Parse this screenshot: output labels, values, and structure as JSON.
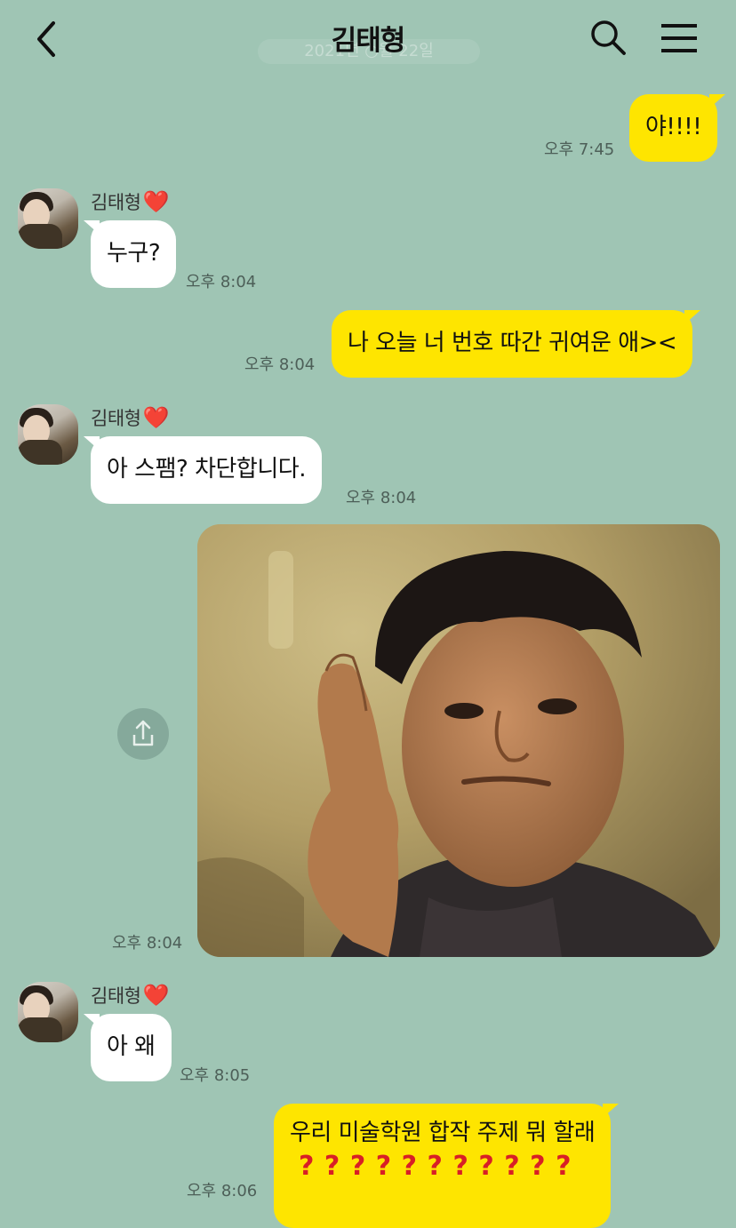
{
  "header": {
    "title": "김태형",
    "date_faded": "2021년 ○월 22일",
    "back_icon": "chevron-left-icon",
    "search_icon": "search-icon",
    "menu_icon": "menu-icon"
  },
  "contact": {
    "name": "김태형",
    "heart": "❤️"
  },
  "messages": [
    {
      "from": "me",
      "text": "야!!!!",
      "time": "오후 7:45"
    },
    {
      "from": "them",
      "text": "누구?",
      "time": "오후 8:04"
    },
    {
      "from": "me",
      "text": "나 오늘 너 번호 따간 귀여운 애><",
      "time": "오후 8:04"
    },
    {
      "from": "them",
      "text": "아 스팸? 차단합니다.",
      "time": "오후 8:04"
    },
    {
      "from": "me",
      "type": "photo",
      "time": "오후 8:04"
    },
    {
      "from": "them",
      "text": "아 왜",
      "time": "오후 8:05"
    },
    {
      "from": "me",
      "text": "우리 미술학원 합작 주제 뭐 할래",
      "time": "오후 8:06",
      "question_marks": [
        "?",
        "?",
        "?",
        "?",
        "?",
        "?",
        "?",
        "?",
        "?",
        "?",
        "?"
      ]
    }
  ],
  "colors": {
    "background": "#9fc5b4",
    "outgoing_bubble": "#fee500",
    "incoming_bubble": "#ffffff",
    "question_mark": "#d81f26"
  }
}
